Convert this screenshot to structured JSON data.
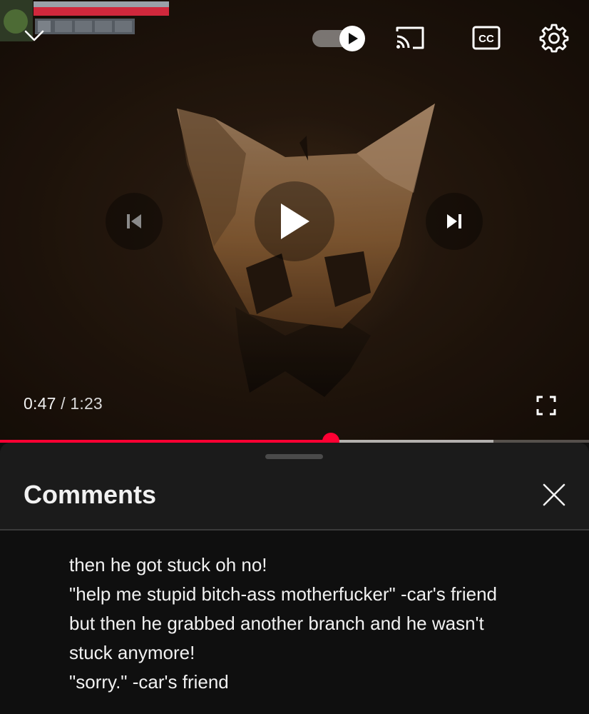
{
  "player": {
    "current_time": "0:47",
    "separator": "/",
    "duration": "1:23",
    "progress_fraction": 0.562,
    "buffered_fraction": 0.838,
    "icons": {
      "collapse": "chevron-down-icon",
      "autoplay": "autoplay-toggle-icon",
      "cast": "cast-icon",
      "captions": "closed-captions-icon",
      "settings": "gear-icon",
      "previous": "skip-previous-icon",
      "play": "play-icon",
      "next": "skip-next-icon",
      "fullscreen": "fullscreen-icon"
    },
    "captions_label": "CC",
    "colors": {
      "progress": "#ff0033",
      "scrubber": "#ff0033"
    },
    "autoplay_on": true
  },
  "comments_panel": {
    "title": "Comments",
    "close_icon": "close-icon",
    "lines": [
      "then he got stuck oh no!",
      "\"help me stupid bitch-ass motherfucker\" -car's friend",
      "but then he grabbed another branch and he wasn't",
      "stuck anymore!",
      "\"sorry.\" -car's friend"
    ]
  }
}
